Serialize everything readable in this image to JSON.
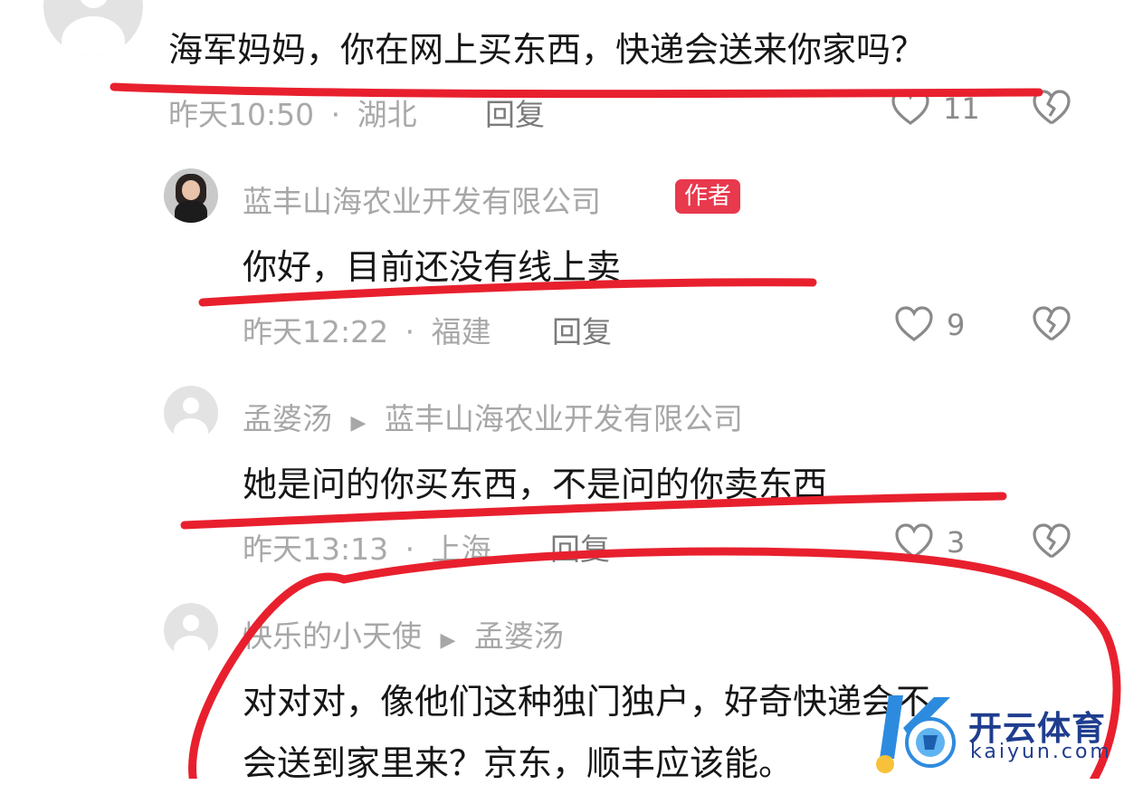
{
  "comments": [
    {
      "text": "海军妈妈，你在网上买东西，快递会送来你家吗？",
      "time": "昨天10:50",
      "sep": "·",
      "location": "湖北",
      "reply": "回复",
      "likes": "11"
    },
    {
      "author": "蓝丰山海农业开发有限公司",
      "badge": "作者",
      "text": "你好，目前还没有线上卖",
      "time": "昨天12:22",
      "sep": "·",
      "location": "福建",
      "reply": "回复",
      "likes": "9"
    },
    {
      "author": "孟婆汤",
      "arrow": "▶",
      "reply_to": "蓝丰山海农业开发有限公司",
      "text": "她是问的你买东西，不是问的你卖东西",
      "time": "昨天13:13",
      "sep": "·",
      "location": "上海",
      "reply": "回复",
      "likes": "3"
    },
    {
      "author": "快乐的小天使",
      "arrow": "▶",
      "reply_to": "孟婆汤",
      "text_line1": "对对对，像他们这种独门独户，好奇快递会不",
      "text_line2": "会送到家里来？京东，顺丰应该能。"
    }
  ],
  "watermark": {
    "brand": "开云体育",
    "domain": "kaiyun.com"
  },
  "colors": {
    "annotation_red": "#e8202e",
    "badge_red": "#e8394d"
  },
  "icons": [
    "avatar-placeholder-icon",
    "heart-icon",
    "broken-heart-icon"
  ]
}
